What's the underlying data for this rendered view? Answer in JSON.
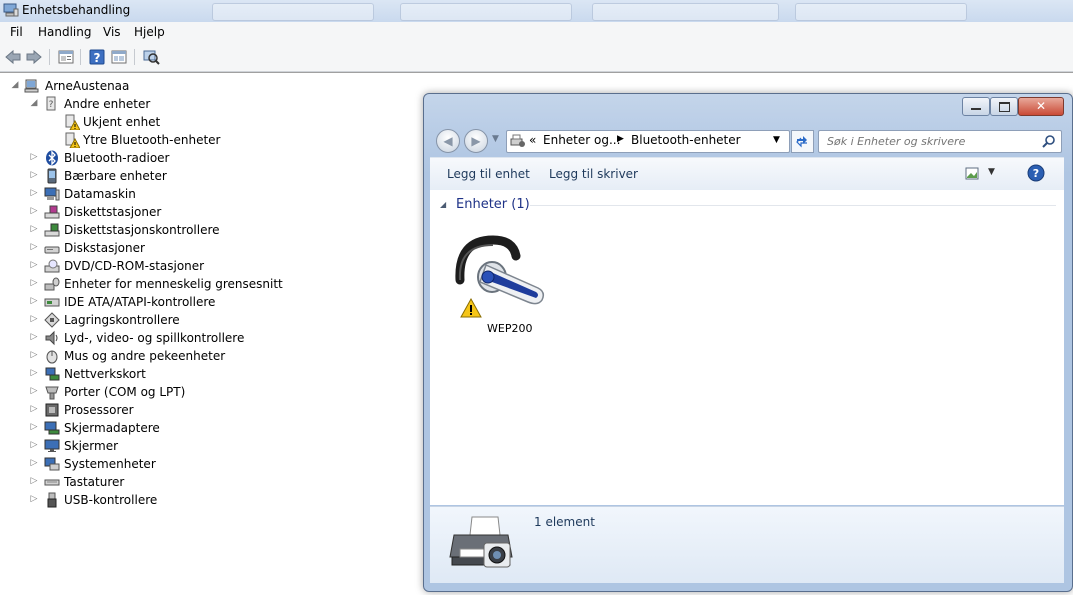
{
  "window": {
    "title": "Enhetsbehandling"
  },
  "menu": {
    "items": [
      "Fil",
      "Handling",
      "Vis",
      "Hjelp"
    ]
  },
  "toolbar": {
    "buttons": [
      "back-arrow-icon",
      "forward-arrow-icon",
      "properties-icon",
      "help-icon",
      "view-icon",
      "scan-hardware-icon"
    ]
  },
  "tree": {
    "root": "ArneAustenaa",
    "items": [
      {
        "label": "Andre enheter",
        "expanded": true,
        "icon": "unknown-device-icon"
      },
      {
        "label": "Ukjent enhet",
        "child": true,
        "icon": "warning-device-icon"
      },
      {
        "label": "Ytre Bluetooth-enheter",
        "child": true,
        "icon": "warning-device-icon"
      },
      {
        "label": "Bluetooth-radioer",
        "icon": "bluetooth-icon"
      },
      {
        "label": "Bærbare enheter",
        "icon": "portable-device-icon"
      },
      {
        "label": "Datamaskin",
        "icon": "computer-icon"
      },
      {
        "label": "Diskettstasjoner",
        "icon": "floppy-drive-icon"
      },
      {
        "label": "Diskettstasjonskontrollere",
        "icon": "floppy-controller-icon"
      },
      {
        "label": "Diskstasjoner",
        "icon": "disk-drive-icon"
      },
      {
        "label": "DVD/CD-ROM-stasjoner",
        "icon": "dvd-drive-icon"
      },
      {
        "label": "Enheter for menneskelig grensesnitt",
        "icon": "hid-icon"
      },
      {
        "label": "IDE ATA/ATAPI-kontrollere",
        "icon": "ide-controller-icon"
      },
      {
        "label": "Lagringskontrollere",
        "icon": "storage-controller-icon"
      },
      {
        "label": "Lyd-, video- og spillkontrollere",
        "icon": "sound-icon"
      },
      {
        "label": "Mus og andre pekeenheter",
        "icon": "mouse-icon"
      },
      {
        "label": "Nettverkskort",
        "icon": "network-adapter-icon"
      },
      {
        "label": "Porter (COM og LPT)",
        "icon": "port-icon"
      },
      {
        "label": "Prosessorer",
        "icon": "processor-icon"
      },
      {
        "label": "Skjermadaptere",
        "icon": "display-adapter-icon"
      },
      {
        "label": "Skjermer",
        "icon": "monitor-icon"
      },
      {
        "label": "Systemenheter",
        "icon": "system-device-icon"
      },
      {
        "label": "Tastaturer",
        "icon": "keyboard-icon"
      },
      {
        "label": "USB-kontrollere",
        "icon": "usb-icon"
      }
    ]
  },
  "devices_window": {
    "breadcrumb": {
      "overflow": "«",
      "segments": [
        "Enheter og...",
        "Bluetooth-enheter"
      ]
    },
    "search_placeholder": "Søk i Enheter og skrivere",
    "commands": {
      "add_device": "Legg til enhet",
      "add_printer": "Legg til skriver"
    },
    "group_header": "Enheter (1)",
    "devices": [
      {
        "name": "WEP200",
        "icon": "bluetooth-headset-icon",
        "warning": true
      }
    ],
    "status": "1 element"
  },
  "colors": {
    "group_header": "#1e3287",
    "warning": "#f5c518",
    "window_frame": "#b8cce6"
  }
}
